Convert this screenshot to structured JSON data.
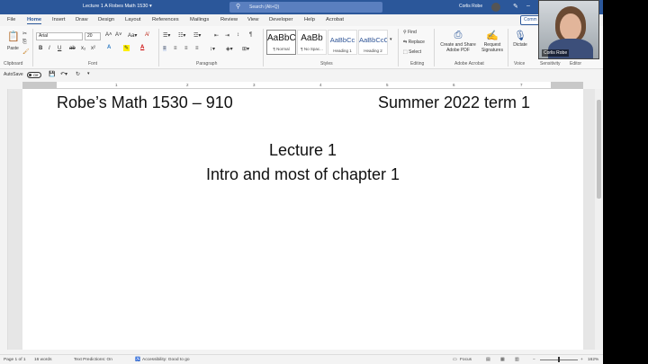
{
  "window": {
    "doc_title": "Lecture 1 A Robes Math 1530 ▾",
    "search_placeholder": "Search (Alt+Q)",
    "user_name": "Corlis Robe"
  },
  "tabs": [
    "File",
    "Home",
    "Insert",
    "Draw",
    "Design",
    "Layout",
    "References",
    "Mailings",
    "Review",
    "View",
    "Developer",
    "Help",
    "Acrobat"
  ],
  "active_tab": "Home",
  "comments_label": "Comm",
  "ribbon": {
    "clipboard": {
      "label": "Clipboard",
      "paste": "Paste"
    },
    "font": {
      "label": "Font",
      "family": "Arial",
      "size": "20"
    },
    "paragraph": {
      "label": "Paragraph"
    },
    "styles": {
      "label": "Styles",
      "items": [
        {
          "preview": "AaBbC",
          "name": "¶ Normal"
        },
        {
          "preview": "AaBb",
          "name": "¶ No Spac..."
        },
        {
          "preview": "AaBbCc",
          "name": "Heading 1"
        },
        {
          "preview": "AaBbCcC",
          "name": "Heading 2"
        }
      ]
    },
    "editing": {
      "label": "Editing",
      "find": "Find",
      "replace": "Replace",
      "select": "Select"
    },
    "acrobat": {
      "label": "Adobe Acrobat",
      "create_share": "Create and Share Adobe PDF",
      "request_sig": "Request Signatures"
    },
    "voice": {
      "label": "Voice",
      "dictate": "Dictate"
    },
    "sensitivity": {
      "label": "Sensitivity"
    },
    "editor": {
      "label": "Editor"
    }
  },
  "qat": {
    "autosave": "AutoSave",
    "toggle": "Off"
  },
  "ruler_numbers": [
    "1",
    "2",
    "3",
    "4",
    "5",
    "6",
    "7"
  ],
  "document": {
    "header_left": "Robe’s Math 1530 – 910",
    "header_right": "Summer 2022 term 1",
    "line1": "Lecture 1",
    "line2": "Intro and most of chapter 1"
  },
  "status": {
    "page": "Page 1 of 1",
    "words": "16 words",
    "predictions": "Text Predictions: On",
    "accessibility": "Accessibility: Good to go",
    "focus": "Focus",
    "zoom": "162%"
  },
  "webcam": {
    "name": "Corlis Robe"
  }
}
